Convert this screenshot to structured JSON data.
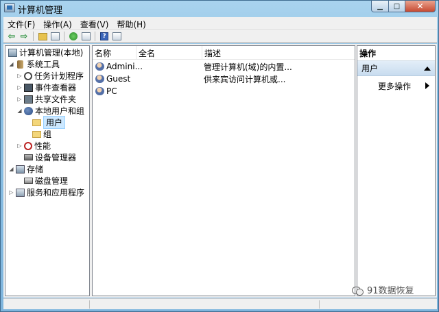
{
  "window": {
    "title": "计算机管理"
  },
  "menu": [
    "文件(F)",
    "操作(A)",
    "查看(V)",
    "帮助(H)"
  ],
  "toolbar": {
    "buttons": [
      "back-icon",
      "forward-icon",
      "up-icon",
      "show-hide-tree-icon",
      "refresh-icon",
      "export-icon",
      "help-icon",
      "properties-icon"
    ]
  },
  "tree": {
    "root": "计算机管理(本地)",
    "system_tools": "系统工具",
    "task_scheduler": "任务计划程序",
    "event_viewer": "事件查看器",
    "shared_folders": "共享文件夹",
    "local_users_groups": "本地用户和组",
    "users": "用户",
    "groups": "组",
    "performance": "性能",
    "device_manager": "设备管理器",
    "storage": "存储",
    "disk_management": "磁盘管理",
    "services_apps": "服务和应用程序"
  },
  "list": {
    "columns": {
      "name": "名称",
      "full_name": "全名",
      "description": "描述"
    },
    "rows": [
      {
        "name": "Admini...",
        "full_name": "",
        "description": "管理计算机(域)的内置..."
      },
      {
        "name": "Guest",
        "full_name": "",
        "description": "供来宾访问计算机或..."
      },
      {
        "name": "PC",
        "full_name": "",
        "description": ""
      }
    ]
  },
  "actions": {
    "header": "操作",
    "section": "用户",
    "more": "更多操作"
  },
  "watermark": {
    "text": "91数据恢复"
  },
  "colors": {
    "selection": "#cce8ff",
    "frame": "#8cc0e4",
    "close": "#c74a31"
  }
}
